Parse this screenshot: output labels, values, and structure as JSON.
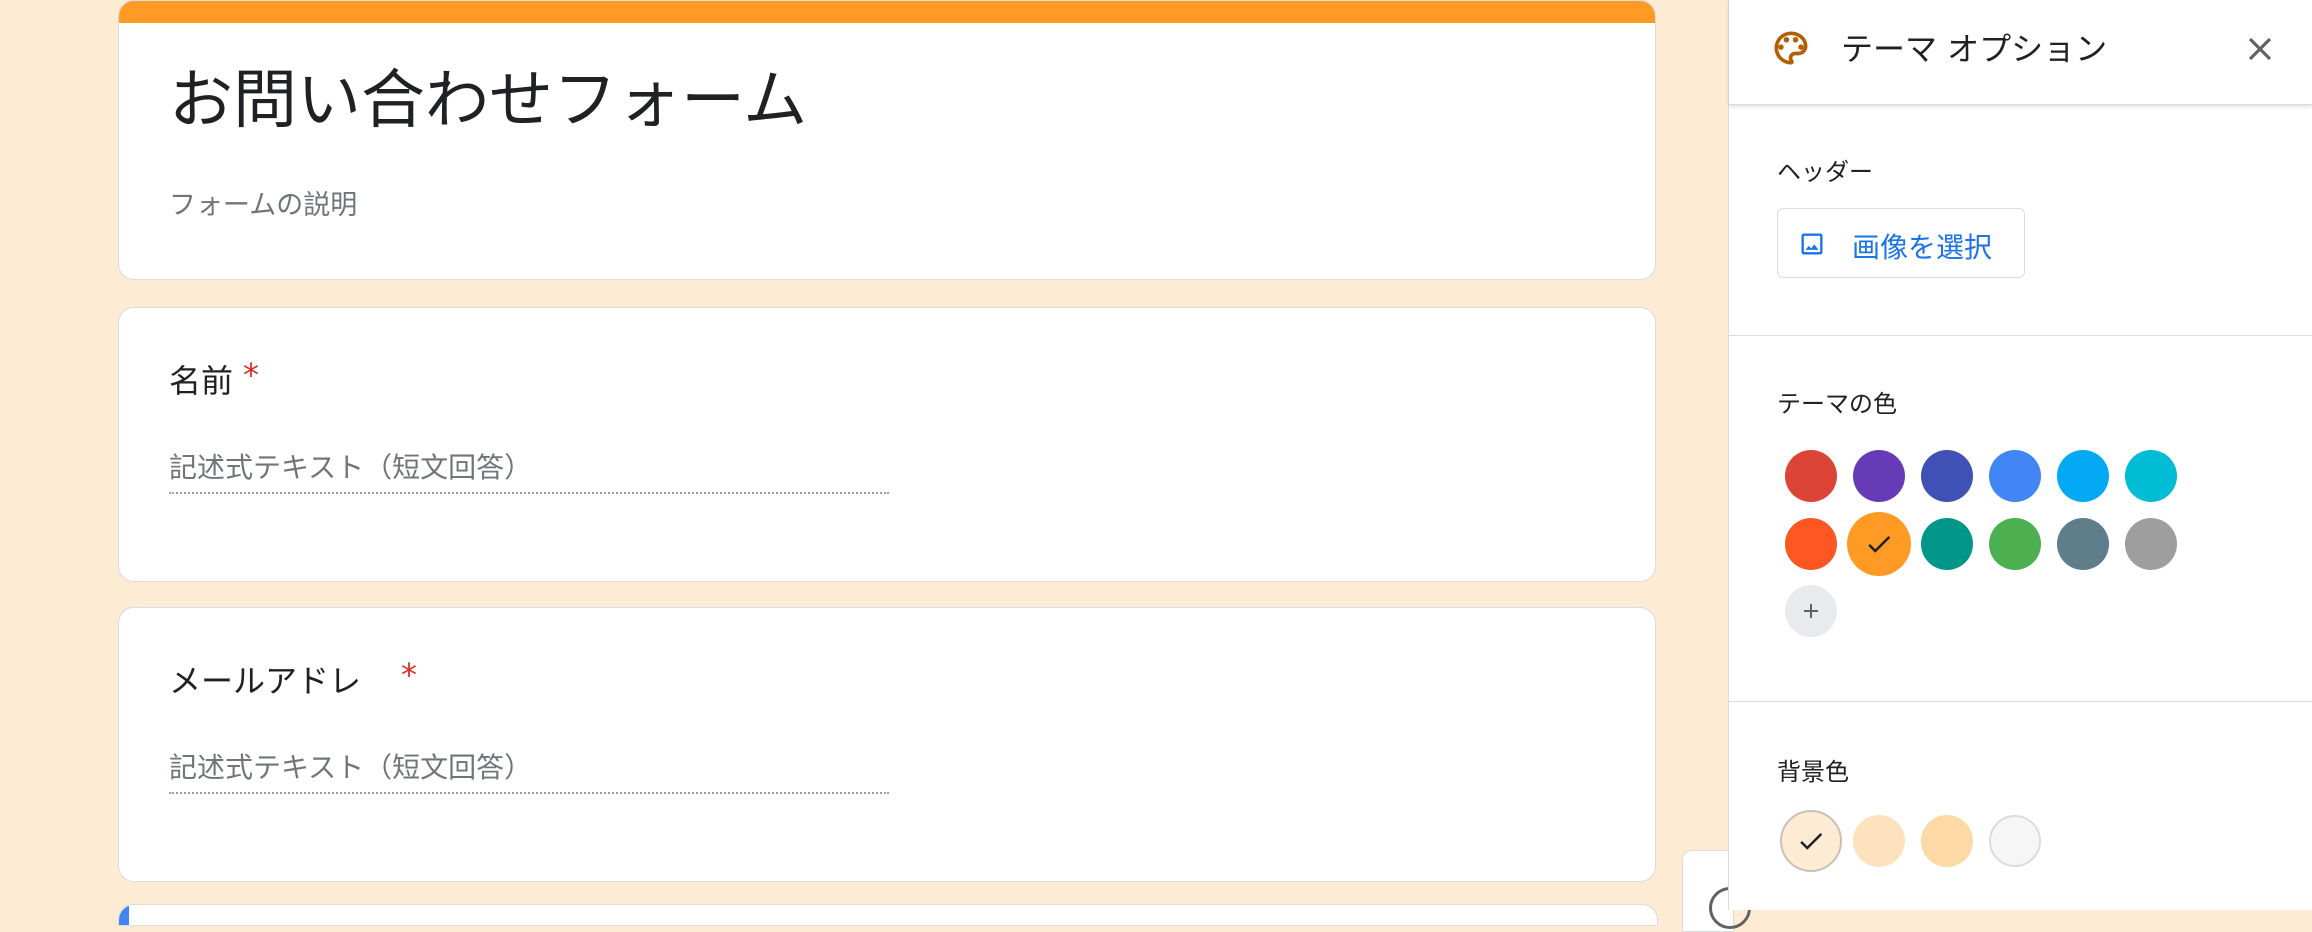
{
  "form": {
    "title": "お問い合わせフォーム",
    "description_placeholder": "フォームの説明",
    "questions": [
      {
        "label": "名前",
        "required_mark": "*",
        "answer_placeholder": "記述式テキスト（短文回答）"
      },
      {
        "label": "メールアドレ",
        "required_mark": "*",
        "answer_placeholder": "記述式テキスト（短文回答）"
      }
    ],
    "header_color": "#ff9b24"
  },
  "panel": {
    "title": "テーマ オプション",
    "header_section": {
      "label": "ヘッダー",
      "select_image_label": "画像を選択"
    },
    "theme_color_section": {
      "label": "テーマの色",
      "selected_color": "#ff9b24",
      "colors": [
        "#db4437",
        "#673ab7",
        "#3f51b5",
        "#4285f4",
        "#03a9f4",
        "#00bcd4",
        "#ff5722",
        "#ff9b24",
        "#009688",
        "#4caf50",
        "#607d8b",
        "#9e9e9e"
      ],
      "add_icon": "plus-icon"
    },
    "background_section": {
      "label": "背景色",
      "selected_color": "#fdebd3",
      "colors": [
        "#fdebd3",
        "#fde2bd",
        "#fdd9a6",
        "#f6f6f6"
      ]
    },
    "icons": {
      "palette": "palette-icon",
      "close": "close-icon",
      "image": "image-icon",
      "check": "check-icon"
    }
  }
}
